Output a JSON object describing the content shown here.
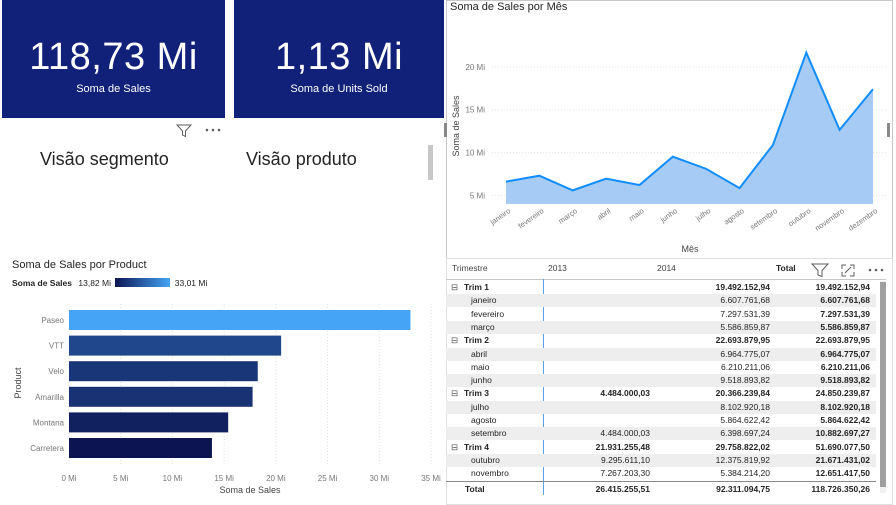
{
  "cards": [
    {
      "value": "118,73 Mi",
      "label": "Soma de  Sales"
    },
    {
      "value": "1,13 Mi",
      "label": "Soma de Units Sold"
    }
  ],
  "slicers": {
    "segmento": "Visão segmento",
    "produto": "Visão produto"
  },
  "icons": {
    "filter": "filter-icon",
    "more": "more-options-icon",
    "focus": "focus-mode-icon"
  },
  "line_chart": {
    "title": "Soma de Sales por Mês",
    "xlabel": "Mês",
    "ylabel": "Soma de Sales",
    "yticks": [
      "5 Mi",
      "10 Mi",
      "15 Mi",
      "20 Mi"
    ]
  },
  "bar_chart": {
    "title": "Soma de Sales por Product",
    "legend_label": "Soma de  Sales",
    "legend_min": "13,82 Mi",
    "legend_max": "33,01 Mi",
    "xlabel": "Soma de Sales",
    "ylabel": "Product",
    "xticks": [
      "0 Mi",
      "5 Mi",
      "10 Mi",
      "15 Mi",
      "20 Mi",
      "25 Mi",
      "30 Mi",
      "35 Mi"
    ]
  },
  "chart_data": [
    {
      "type": "area",
      "title": "Soma de Sales por Mês",
      "xlabel": "Mês",
      "ylabel": "Soma de Sales",
      "categories": [
        "janeiro",
        "fevereiro",
        "março",
        "abril",
        "maio",
        "junho",
        "julho",
        "agosto",
        "setembro",
        "outubro",
        "novembro",
        "dezembro"
      ],
      "values": [
        6.61,
        7.3,
        5.59,
        6.96,
        6.21,
        9.52,
        8.1,
        5.86,
        10.88,
        21.67,
        12.65,
        17.4
      ],
      "ylim": [
        4,
        25
      ],
      "color": "#118dff",
      "fill": "#a6cbf5"
    },
    {
      "type": "bar",
      "orientation": "horizontal",
      "title": "Soma de Sales por Product",
      "xlabel": "Soma de Sales",
      "ylabel": "Product",
      "categories": [
        "Paseo",
        "VTT",
        "Velo",
        "Amarilla",
        "Montana",
        "Carretera"
      ],
      "values": [
        33.01,
        20.51,
        18.25,
        17.75,
        15.39,
        13.82
      ],
      "xlim": [
        0,
        35
      ],
      "color_low": "#0c1552",
      "color_high": "#45a4f5"
    }
  ],
  "matrix": {
    "headers": {
      "label": "Trimestre",
      "c2013": "2013",
      "c2014": "2014",
      "total": "Total"
    },
    "rows": [
      {
        "label": "Trim 1",
        "c2013": "",
        "c2014": "19.492.152,94",
        "total": "19.492.152,94",
        "level": 0
      },
      {
        "label": "janeiro",
        "c2013": "",
        "c2014": "6.607.761,68",
        "total": "6.607.761,68",
        "level": 1
      },
      {
        "label": "fevereiro",
        "c2013": "",
        "c2014": "7.297.531,39",
        "total": "7.297.531,39",
        "level": 1
      },
      {
        "label": "março",
        "c2013": "",
        "c2014": "5.586.859,87",
        "total": "5.586.859,87",
        "level": 1
      },
      {
        "label": "Trim 2",
        "c2013": "",
        "c2014": "22.693.879,95",
        "total": "22.693.879,95",
        "level": 0
      },
      {
        "label": "abril",
        "c2013": "",
        "c2014": "6.964.775,07",
        "total": "6.964.775,07",
        "level": 1
      },
      {
        "label": "maio",
        "c2013": "",
        "c2014": "6.210.211,06",
        "total": "6.210.211,06",
        "level": 1
      },
      {
        "label": "junho",
        "c2013": "",
        "c2014": "9.518.893,82",
        "total": "9.518.893,82",
        "level": 1
      },
      {
        "label": "Trim 3",
        "c2013": "4.484.000,03",
        "c2014": "20.366.239,84",
        "total": "24.850.239,87",
        "level": 0
      },
      {
        "label": "julho",
        "c2013": "",
        "c2014": "8.102.920,18",
        "total": "8.102.920,18",
        "level": 1
      },
      {
        "label": "agosto",
        "c2013": "",
        "c2014": "5.864.622,42",
        "total": "5.864.622,42",
        "level": 1
      },
      {
        "label": "setembro",
        "c2013": "4.484.000,03",
        "c2014": "6.398.697,24",
        "total": "10.882.697,27",
        "level": 1
      },
      {
        "label": "Trim 4",
        "c2013": "21.931.255,48",
        "c2014": "29.758.822,02",
        "total": "51.690.077,50",
        "level": 0
      },
      {
        "label": "outubro",
        "c2013": "9.295.611,10",
        "c2014": "12.375.819,92",
        "total": "21.671.431,02",
        "level": 1
      },
      {
        "label": "novembro",
        "c2013": "7.267.203,30",
        "c2014": "5.384.214,20",
        "total": "12.651.417,50",
        "level": 1
      }
    ],
    "total_row": {
      "label": "Total",
      "c2013": "26.415.255,51",
      "c2014": "92.311.094,75",
      "total": "118.726.350,26"
    }
  }
}
